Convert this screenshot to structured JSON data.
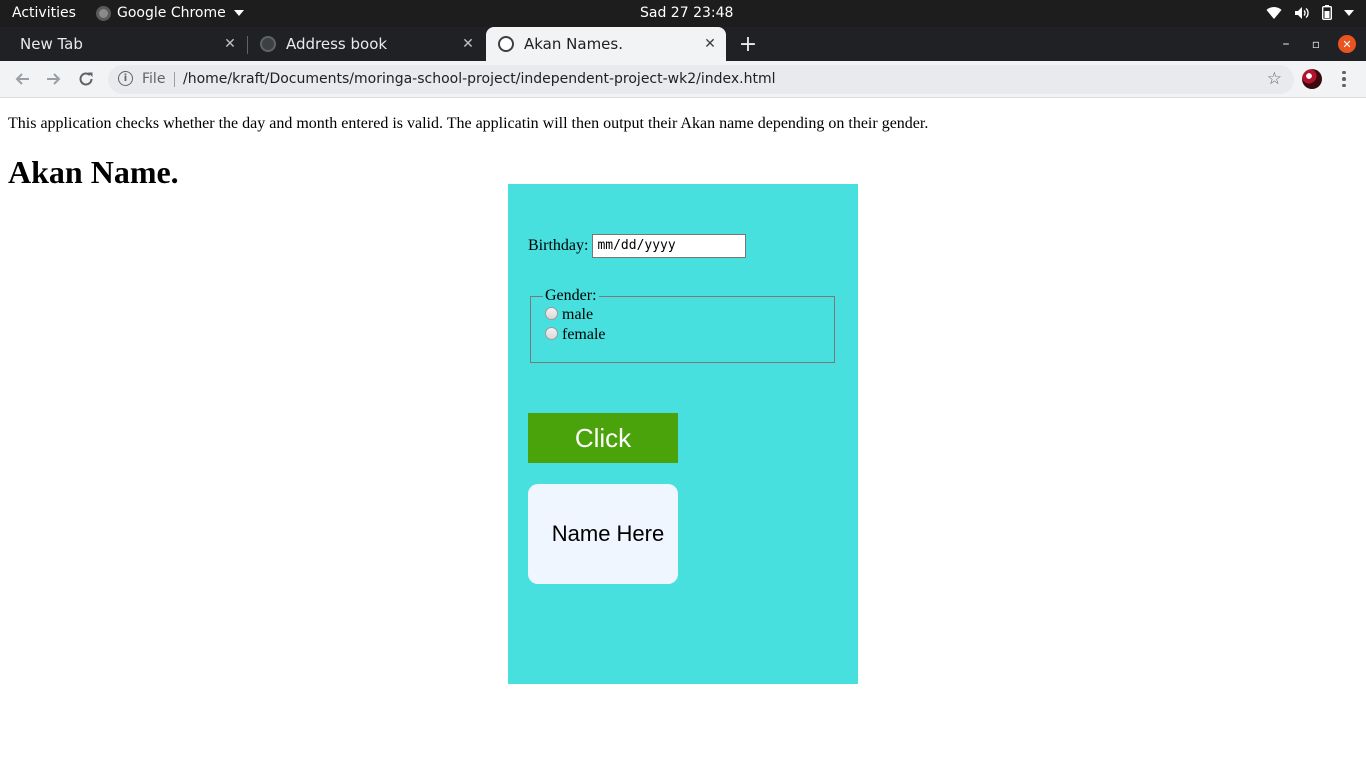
{
  "system_bar": {
    "activities": "Activities",
    "app_name": "Google Chrome",
    "clock": "Sad 27  23:48"
  },
  "tabs": [
    {
      "label": "New Tab",
      "active": false
    },
    {
      "label": "Address book",
      "active": false
    },
    {
      "label": "Akan Names.",
      "active": true
    }
  ],
  "address_bar": {
    "scheme_label": "File",
    "url": "/home/kraft/Documents/moringa-school-project/independent-project-wk2/index.html"
  },
  "page": {
    "intro": "This application checks whether the day and month entered is valid. The applicatin will then output their Akan name depending on their gender.",
    "heading": "Akan Name.",
    "form": {
      "birthday_label": "Birthday:",
      "date_placeholder": "mm/dd/yyyy",
      "gender_legend": "Gender:",
      "options": [
        "male",
        "female"
      ],
      "submit_label": "Click",
      "output_text": "Name Here"
    }
  },
  "colors": {
    "card_bg": "#48e0df",
    "button_bg": "#4aa30a",
    "output_bg": "#f0f6ff",
    "ubuntu_close": "#e95420"
  }
}
